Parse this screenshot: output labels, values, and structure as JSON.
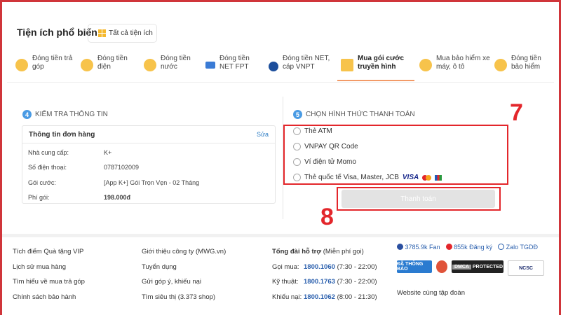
{
  "header": {
    "title": "Tiện ích phổ biến",
    "all_button": "Tất cả tiện ích"
  },
  "tabs": [
    {
      "label": "Đóng tiền trả góp"
    },
    {
      "label": "Đóng tiền điện"
    },
    {
      "label": "Đóng tiền nước"
    },
    {
      "label": "Đóng tiền NET FPT"
    },
    {
      "label": "Đóng tiền NET, cáp VNPT"
    },
    {
      "label": "Mua gói cước truyền hình",
      "active": true
    },
    {
      "label": "Mua bảo hiểm xe máy, ô tô"
    },
    {
      "label": "Đóng tiền bảo hiểm"
    }
  ],
  "check": {
    "step": "4",
    "title": "KIỂM TRA THÔNG TIN",
    "card_title": "Thông tin đơn hàng",
    "edit": "Sửa",
    "rows": [
      {
        "label": "Nhà cung cấp:",
        "value": "K+"
      },
      {
        "label": "Số điện thoại:",
        "value": "0787102009"
      },
      {
        "label": "Gói cước:",
        "value": "[App K+] Gói Trọn Vẹn - 02 Tháng"
      },
      {
        "label": "Phí gói:",
        "value": "198.000đ"
      }
    ]
  },
  "payment": {
    "step": "5",
    "title": "CHỌN HÌNH THỨC THANH TOÁN",
    "options": [
      "Thẻ ATM",
      "VNPAY QR Code",
      "Ví điện tử Momo",
      "Thẻ quốc tế Visa, Master, JCB"
    ],
    "visa": "VISA",
    "button": "Thanh toán"
  },
  "annotations": {
    "a7": "7",
    "a8": "8"
  },
  "footer": {
    "col1": [
      "Tích điểm Quà tặng VIP",
      "Lịch sử mua hàng",
      "Tìm hiểu về mua trả góp",
      "Chính sách bảo hành"
    ],
    "col2": [
      "Giới thiệu công ty (MWG.vn)",
      "Tuyển dụng",
      "Gửi góp ý, khiếu nại",
      "Tìm siêu thị (3.373 shop)"
    ],
    "hotline_title": "Tổng đài hỗ trợ",
    "hotline_note": "(Miễn phí gọi)",
    "hotlines": [
      {
        "label": "Gọi mua:",
        "num": "1800.1060",
        "time": "(7:30 - 22:00)"
      },
      {
        "label": "Kỹ thuật:",
        "num": "1800.1763",
        "time": "(7:30 - 22:00)"
      },
      {
        "label": "Khiếu nại:",
        "num": "1800.1062",
        "time": "(8:00 - 21:30)"
      }
    ],
    "social": {
      "fb": "3785.9k Fan",
      "yt": "855k Đăng ký",
      "zalo": "Zalo TGDĐ"
    },
    "badges": {
      "bct": "ĐÃ THÔNG BÁO",
      "dmca": "DMCA",
      "protected": "PROTECTED",
      "ncsc": "NCSC"
    },
    "group": "Website cùng tập đoàn"
  },
  "colors": {
    "accent": "#f29a67",
    "annotation": "#e3262b",
    "link": "#2a5fad"
  }
}
